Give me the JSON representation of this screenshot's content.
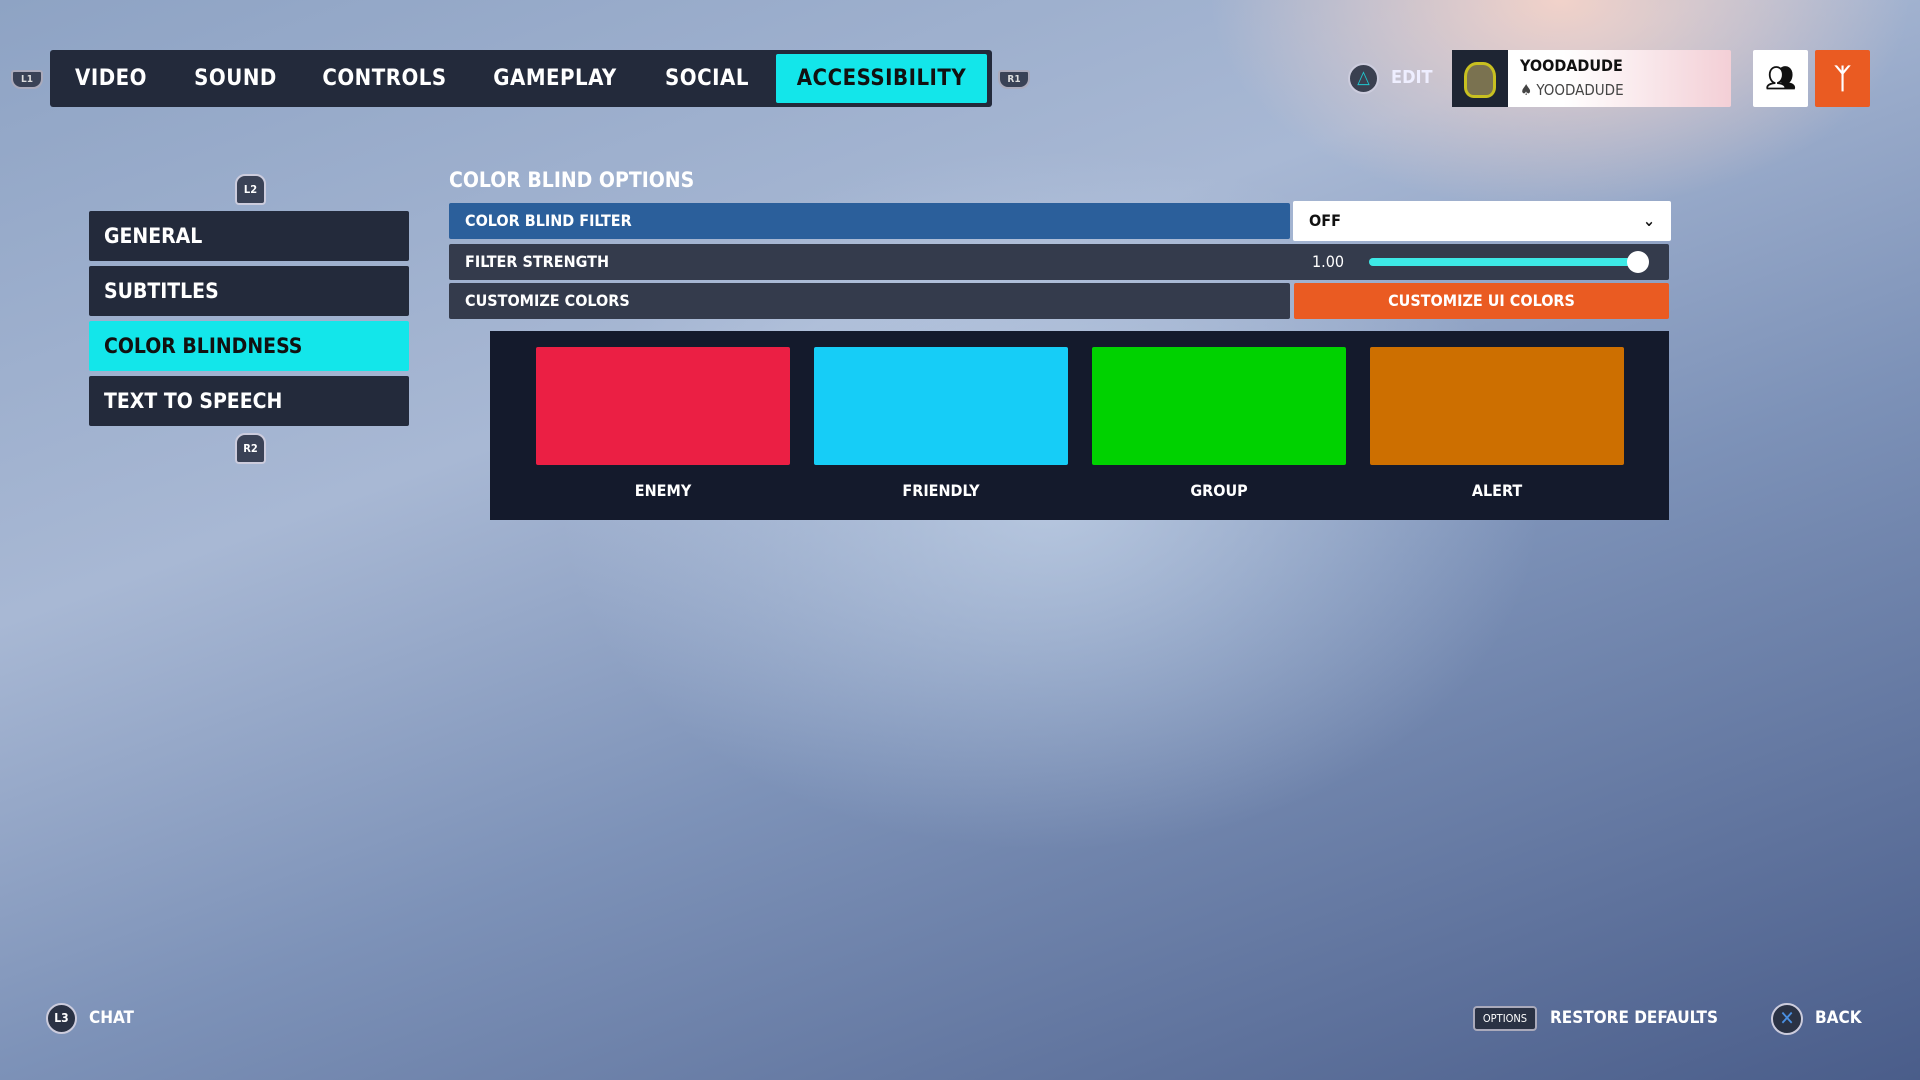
{
  "tabs": {
    "left_bumper": "L1",
    "right_bumper": "R1",
    "items": [
      {
        "label": "VIDEO"
      },
      {
        "label": "SOUND"
      },
      {
        "label": "CONTROLS"
      },
      {
        "label": "GAMEPLAY"
      },
      {
        "label": "SOCIAL"
      },
      {
        "label": "ACCESSIBILITY",
        "active": true
      }
    ]
  },
  "header": {
    "edit_label": "EDIT",
    "edit_button_icon": "triangle-icon",
    "player_name": "YOODADUDE",
    "platform_name": "YOODADUDE",
    "social_icon": "group-icon",
    "rewards_icon": "medal-icon"
  },
  "sidebar": {
    "top_trigger": "L2",
    "bottom_trigger": "R2",
    "items": [
      {
        "label": "GENERAL"
      },
      {
        "label": "SUBTITLES"
      },
      {
        "label": "COLOR BLINDNESS",
        "active": true
      },
      {
        "label": "TEXT TO SPEECH"
      }
    ]
  },
  "section": {
    "title": "COLOR BLIND OPTIONS",
    "filter": {
      "label": "COLOR BLIND FILTER",
      "value": "OFF"
    },
    "strength": {
      "label": "FILTER STRENGTH",
      "value": "1.00",
      "fraction": 1.0
    },
    "customize": {
      "label": "CUSTOMIZE COLORS",
      "button": "CUSTOMIZE UI COLORS"
    },
    "swatches": [
      {
        "label": "ENEMY",
        "color": "#eb1f44"
      },
      {
        "label": "FRIENDLY",
        "color": "#16cdf7"
      },
      {
        "label": "GROUP",
        "color": "#00d200"
      },
      {
        "label": "ALERT",
        "color": "#cd6f00"
      }
    ]
  },
  "colors": {
    "accent": "#13e6ea",
    "orange": "#ea5b22",
    "selected_row": "#2b5f9b",
    "row": "#343b4c"
  },
  "footer": {
    "chat_key": "L3",
    "chat_label": "CHAT",
    "options_key": "OPTIONS",
    "restore_label": "RESTORE DEFAULTS",
    "back_key": "X",
    "back_label": "BACK"
  }
}
